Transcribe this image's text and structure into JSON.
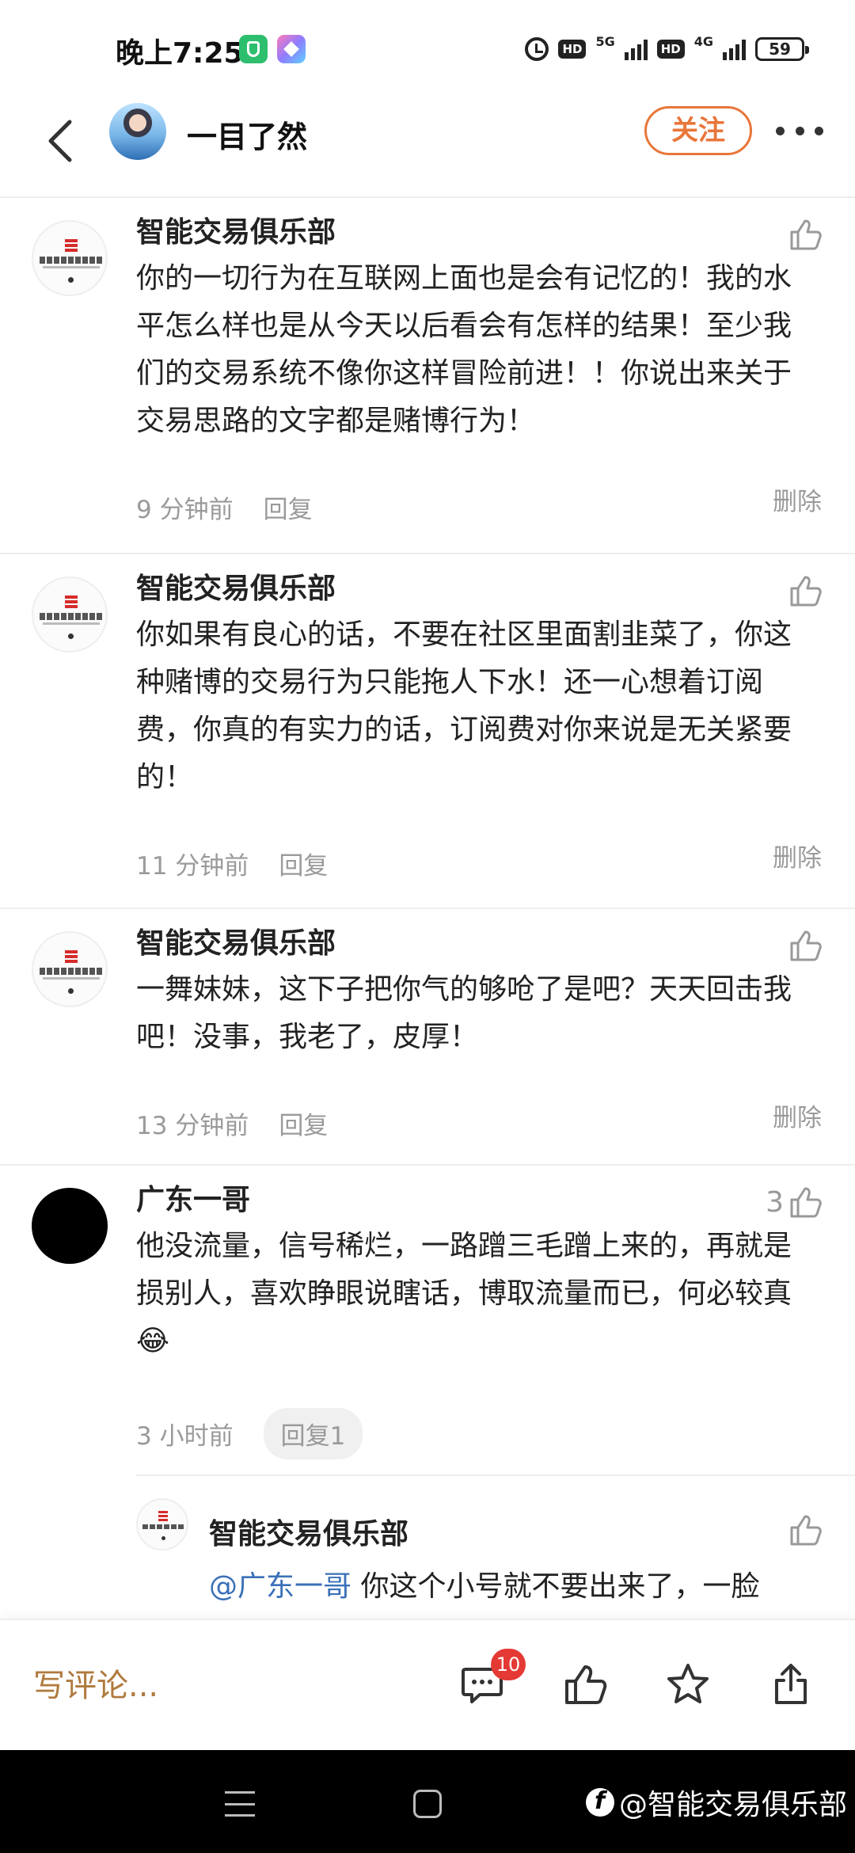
{
  "status_bar": {
    "time": "晚上7:25",
    "hd1": "HD",
    "net1": "5G",
    "hd2": "HD",
    "net2": "4G",
    "battery": "59"
  },
  "header": {
    "user_name": "一目了然",
    "follow_label": "关注"
  },
  "comments": [
    {
      "author": "智能交易俱乐部",
      "text": "你的一切行为在互联网上面也是会有记忆的！我的水平怎么样也是从今天以后看会有怎样的结果！至少我们的交易系统不像你这样冒险前进！！你说出来关于交易思路的文字都是赌博行为！",
      "time": "9 分钟前",
      "reply_label": "回复",
      "delete_label": "删除",
      "likes": ""
    },
    {
      "author": "智能交易俱乐部",
      "text": "你如果有良心的话，不要在社区里面割韭菜了，你这种赌博的交易行为只能拖人下水！还一心想着订阅费，你真的有实力的话，订阅费对你来说是无关紧要的！",
      "time": "11 分钟前",
      "reply_label": "回复",
      "delete_label": "删除",
      "likes": ""
    },
    {
      "author": "智能交易俱乐部",
      "text": "一舞妹妹，这下子把你气的够呛了是吧？天天回击我吧！没事，我老了，皮厚！",
      "time": "13 分钟前",
      "reply_label": "回复",
      "delete_label": "删除",
      "likes": ""
    },
    {
      "author": "广东一哥",
      "text": "他没流量，信号稀烂，一路蹭三毛蹭上来的，再就是损别人，喜欢睁眼说瞎话，博取流量而已，何必较真😂",
      "time": "3 小时前",
      "reply_label": "回复1",
      "likes": "3"
    }
  ],
  "sub_reply": {
    "author": "智能交易俱乐部",
    "mention": "@广东一哥",
    "text": " 你这个小号就不要出来了，一脸"
  },
  "bottom_bar": {
    "write_placeholder": "写评论...",
    "comment_count": "10"
  },
  "watermark": "@智能交易俱乐部",
  "colors": {
    "accent": "#e8763a",
    "mention": "#3a70b8",
    "badge": "#e53935",
    "write": "#b07a3e"
  }
}
